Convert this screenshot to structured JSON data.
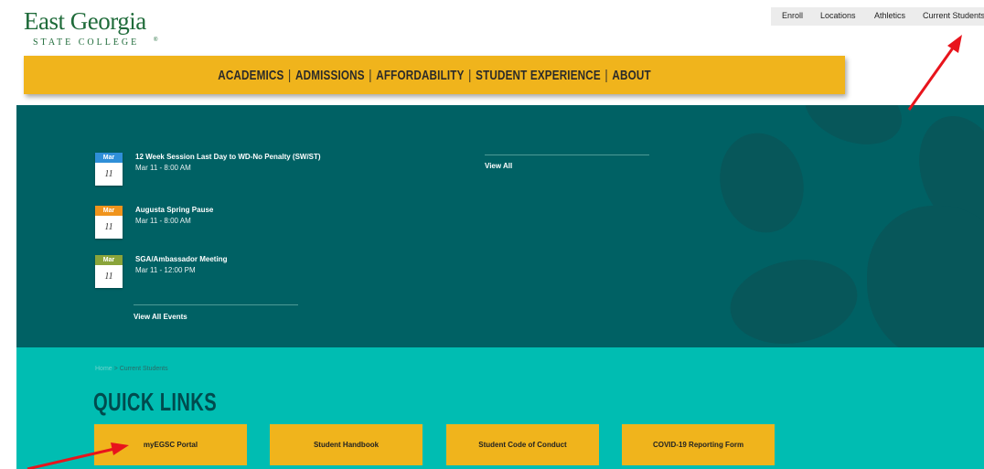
{
  "logo": {
    "name": "East Georgia",
    "sub": "STATE COLLEGE",
    "mark": "®"
  },
  "utility_nav": {
    "items": [
      {
        "label": "Enroll"
      },
      {
        "label": "Locations"
      },
      {
        "label": "Athletics"
      },
      {
        "label": "Current Students"
      }
    ]
  },
  "main_nav": {
    "items": [
      {
        "label": "ACADEMICS"
      },
      {
        "label": "ADMISSIONS"
      },
      {
        "label": "AFFORDABILITY"
      },
      {
        "label": "STUDENT EXPERIENCE"
      },
      {
        "label": "ABOUT"
      }
    ],
    "separator": "|"
  },
  "events": {
    "items": [
      {
        "month": "Mar",
        "day": "11",
        "title": "12 Week Session Last Day to WD-No Penalty (SW/ST)",
        "time": "Mar 11 - 8:00 AM"
      },
      {
        "month": "Mar",
        "day": "11",
        "title": "Augusta Spring Pause",
        "time": "Mar 11 - 8:00 AM"
      },
      {
        "month": "Mar",
        "day": "11",
        "title": "SGA/Ambassador Meeting",
        "time": "Mar 11 - 12:00 PM"
      }
    ],
    "view_all_events": "View All Events",
    "view_all": "View All"
  },
  "breadcrumb": {
    "home": "Home",
    "sep": ">",
    "current": "Current Students"
  },
  "quick_links": {
    "title": "QUICK LINKS",
    "items": [
      {
        "label": "myEGSC Portal"
      },
      {
        "label": "Student Handbook"
      },
      {
        "label": "Student Code of Conduct"
      },
      {
        "label": "COVID-19 Reporting Form"
      }
    ]
  },
  "colors": {
    "brand_green": "#1f6b3a",
    "gold": "#f0b41c",
    "dark_teal": "#006164",
    "light_teal": "#00bdb2",
    "annotation_red": "#e8141c",
    "month_blue": "#2f8fd8",
    "month_orange": "#f0941c",
    "month_olive": "#8aa43a"
  }
}
